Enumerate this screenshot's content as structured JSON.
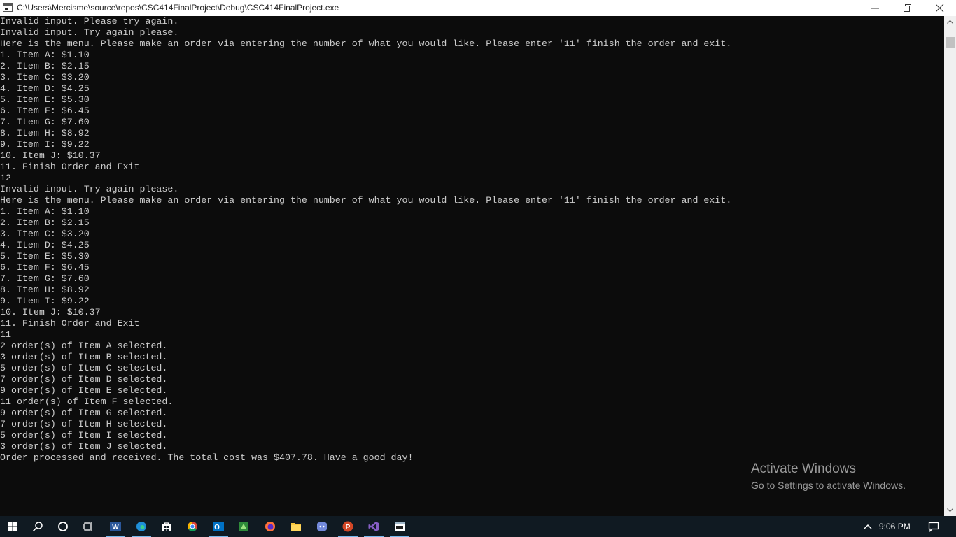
{
  "window": {
    "title": "C:\\Users\\Mercisme\\source\\repos\\CSC414FinalProject\\Debug\\CSC414FinalProject.exe"
  },
  "console": {
    "lines": [
      "Invalid input. Please try again.",
      "Invalid input. Try again please.",
      "Here is the menu. Please make an order via entering the number of what you would like. Please enter '11' finish the order and exit.",
      "1. Item A: $1.10",
      "2. Item B: $2.15",
      "3. Item C: $3.20",
      "4. Item D: $4.25",
      "5. Item E: $5.30",
      "6. Item F: $6.45",
      "7. Item G: $7.60",
      "8. Item H: $8.92",
      "9. Item I: $9.22",
      "10. Item J: $10.37",
      "11. Finish Order and Exit",
      "12",
      "Invalid input. Try again please.",
      "Here is the menu. Please make an order via entering the number of what you would like. Please enter '11' finish the order and exit.",
      "1. Item A: $1.10",
      "2. Item B: $2.15",
      "3. Item C: $3.20",
      "4. Item D: $4.25",
      "5. Item E: $5.30",
      "6. Item F: $6.45",
      "7. Item G: $7.60",
      "8. Item H: $8.92",
      "9. Item I: $9.22",
      "10. Item J: $10.37",
      "11. Finish Order and Exit",
      "11",
      "2 order(s) of Item A selected.",
      "3 order(s) of Item B selected.",
      "5 order(s) of Item C selected.",
      "7 order(s) of Item D selected.",
      "9 order(s) of Item E selected.",
      "11 order(s) of Item F selected.",
      "9 order(s) of Item G selected.",
      "7 order(s) of Item H selected.",
      "5 order(s) of Item I selected.",
      "3 order(s) of Item J selected.",
      "Order processed and received. The total cost was $407.78. Have a good day!"
    ]
  },
  "watermark": {
    "title": "Activate Windows",
    "subtitle": "Go to Settings to activate Windows."
  },
  "taskbar": {
    "clock": "9:06 PM"
  },
  "colors": {
    "console_bg": "#0c0c0c",
    "console_text": "#cccccc",
    "taskbar_bg": "#101a22",
    "accent": "#76b9ed"
  }
}
